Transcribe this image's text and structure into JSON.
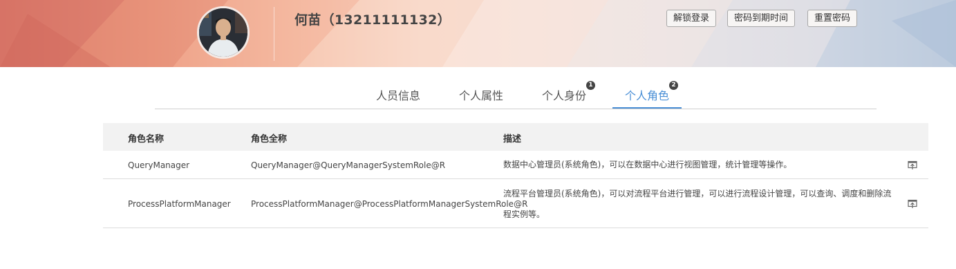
{
  "user": {
    "display_name": "何苗（13211111132）"
  },
  "header": {
    "buttons": {
      "unlock": "解锁登录",
      "password_expiry": "密码到期时间",
      "reset_password": "重置密码"
    }
  },
  "tabs": [
    {
      "label": "人员信息",
      "badge": ""
    },
    {
      "label": "个人属性",
      "badge": ""
    },
    {
      "label": "个人身份",
      "badge": "1"
    },
    {
      "label": "个人角色",
      "badge": "2",
      "active": true
    }
  ],
  "table": {
    "headers": [
      "角色名称",
      "角色全称",
      "描述"
    ],
    "rows": [
      {
        "name": "QueryManager",
        "full_name": "QueryManager@QueryManagerSystemRole@R",
        "description": "数据中心管理员(系统角色)，可以在数据中心进行视图管理，统计管理等操作。",
        "action_icon": "detail-icon"
      },
      {
        "name": "ProcessPlatformManager",
        "full_name": "ProcessPlatformManager@ProcessPlatformManagerSystemRole@R",
        "description": "流程平台管理员(系统角色)，可以对流程平台进行管理，可以进行流程设计管理，可以查询、调度和删除流程实例等。",
        "action_icon": "detail-icon"
      }
    ]
  },
  "colors": {
    "accent": "#4a8fd6",
    "badge": "#444444",
    "header_bg_left": "#d9786a",
    "header_bg_right": "#b9c8da"
  }
}
